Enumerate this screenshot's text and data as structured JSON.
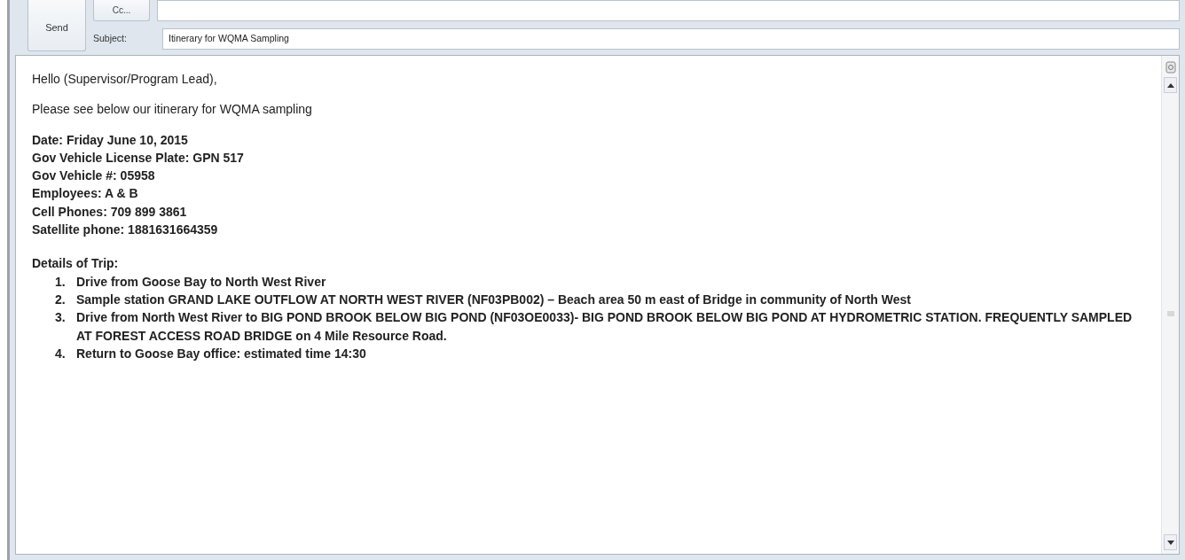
{
  "header": {
    "send_button": "Send",
    "cc_button": "Cc...",
    "subject_label": "Subject:",
    "subject": "Itinerary for WQMA Sampling"
  },
  "body": {
    "greeting": "Hello (Supervisor/Program Lead),",
    "intro": "Please see below our itinerary for WQMA sampling",
    "details": [
      "Date: Friday June 10, 2015",
      "Gov Vehicle License Plate: GPN 517",
      "Gov Vehicle #: 05958",
      "Employees: A & B",
      "Cell Phones: 709 899 3861",
      "Satellite phone: 1881631664359"
    ],
    "trip_heading": "Details of Trip:",
    "trip_steps": [
      {
        "number": "1.",
        "text": "Drive from Goose Bay to North West River"
      },
      {
        "number": "2.",
        "text": "Sample station GRAND LAKE OUTFLOW AT NORTH WEST RIVER (NF03PB002) – Beach area 50 m east of Bridge in community of North West"
      },
      {
        "number": "3.",
        "text": "Drive from North West River to BIG POND BROOK BELOW BIG POND (NF03OE0033)- BIG POND BROOK BELOW BIG POND AT HYDROMETRIC STATION. FREQUENTLY SAMPLED AT FOREST ACCESS ROAD BRIDGE on 4 Mile Resource Road."
      },
      {
        "number": "4.",
        "text": "Return to Goose Bay office: estimated time 14:30"
      }
    ]
  }
}
